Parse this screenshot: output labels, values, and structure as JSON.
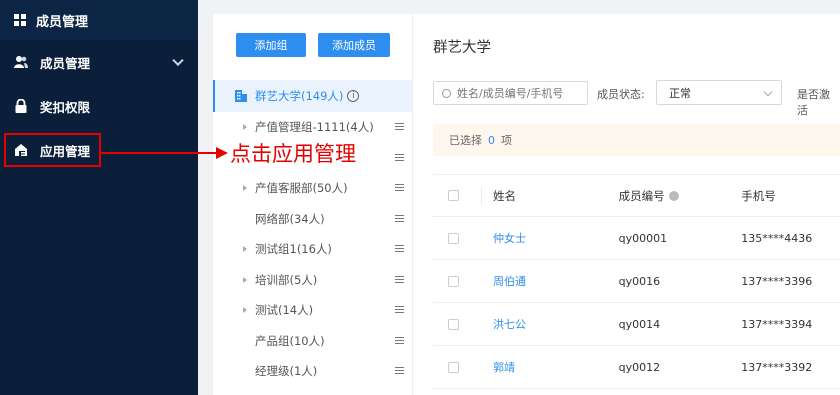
{
  "sidebar": {
    "header": "成员管理",
    "items": [
      {
        "label": "成员管理",
        "icon": "users-icon",
        "expandable": true
      },
      {
        "label": "奖扣权限",
        "icon": "lock-icon"
      },
      {
        "label": "应用管理",
        "icon": "app-icon",
        "highlighted": true
      }
    ]
  },
  "annotation": {
    "text": "点击应用管理",
    "color": "#e60000"
  },
  "tree": {
    "add_group_label": "添加组",
    "add_member_label": "添加成员",
    "root_label": "群艺大学(149人)",
    "rows": [
      {
        "label": "产值管理组-1111(4人)",
        "expandable": true
      },
      {
        "label": "",
        "expandable": true
      },
      {
        "label": "产值客服部(50人)",
        "expandable": true
      },
      {
        "label": "网络部(34人)",
        "expandable": false
      },
      {
        "label": "测试组1(16人)",
        "expandable": true
      },
      {
        "label": "培训部(5人)",
        "expandable": true
      },
      {
        "label": "测试(14人)",
        "expandable": true
      },
      {
        "label": "产品组(10人)",
        "expandable": false
      },
      {
        "label": "经理级(1人)",
        "expandable": false
      }
    ]
  },
  "main": {
    "title": "群艺大学",
    "search_placeholder": "姓名/成员编号/手机号",
    "status_label": "成员状态:",
    "status_value": "正常",
    "activated_label": "是否激活",
    "selected_prefix": "已选择",
    "selected_count": "0",
    "selected_suffix": "项",
    "columns": {
      "name": "姓名",
      "id": "成员编号",
      "phone": "手机号"
    },
    "rows": [
      {
        "name": "仲女士",
        "id": "qy00001",
        "phone": "135****4436"
      },
      {
        "name": "周伯通",
        "id": "qy0016",
        "phone": "137****3396"
      },
      {
        "name": "洪七公",
        "id": "qy0014",
        "phone": "137****3394"
      },
      {
        "name": "郭靖",
        "id": "qy0012",
        "phone": "137****3392"
      }
    ]
  },
  "colors": {
    "primary": "#2e8ef0",
    "sidebar_bg": "#0b1f3a",
    "annotation": "#e60000"
  }
}
